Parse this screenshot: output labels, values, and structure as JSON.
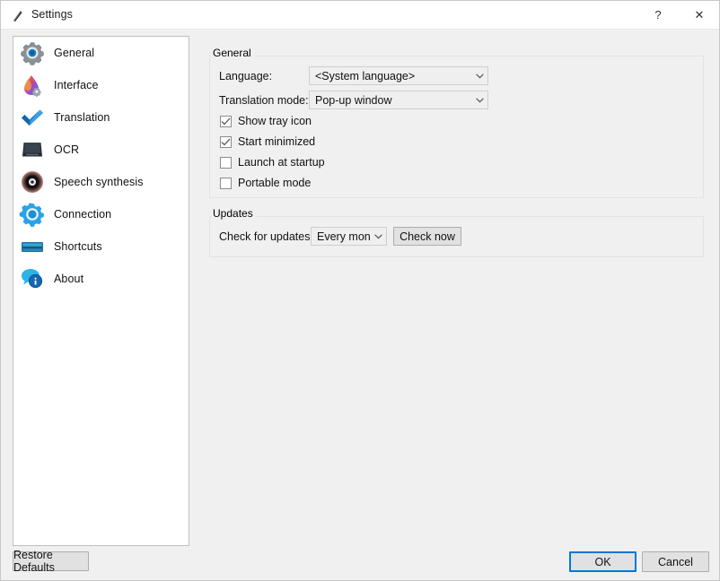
{
  "window": {
    "title": "Settings",
    "icon": "app-icon",
    "help_glyph": "?",
    "close_glyph": "✕"
  },
  "sidebar": {
    "items": [
      {
        "label": "General",
        "icon": "gear-icon",
        "selected": true
      },
      {
        "label": "Interface",
        "icon": "paint-drop-icon",
        "selected": false
      },
      {
        "label": "Translation",
        "icon": "blue-checkmark-icon",
        "selected": false
      },
      {
        "label": "OCR",
        "icon": "scanner-icon",
        "selected": false
      },
      {
        "label": "Speech synthesis",
        "icon": "speaker-disc-icon",
        "selected": false
      },
      {
        "label": "Connection",
        "icon": "blue-gear-icon",
        "selected": false
      },
      {
        "label": "Shortcuts",
        "icon": "keyboard-icon",
        "selected": false
      },
      {
        "label": "About",
        "icon": "info-bubble-icon",
        "selected": false
      }
    ]
  },
  "general": {
    "group_title": "General",
    "language_label": "Language:",
    "language_value": "<System language>",
    "translation_mode_label": "Translation mode:",
    "translation_mode_value": "Pop-up window",
    "checkboxes": [
      {
        "label": "Show tray icon",
        "checked": true
      },
      {
        "label": "Start minimized",
        "checked": true
      },
      {
        "label": "Launch at startup",
        "checked": false
      },
      {
        "label": "Portable mode",
        "checked": false
      }
    ]
  },
  "updates": {
    "group_title": "Updates",
    "check_label": "Check for updates:",
    "interval_value": "Every month",
    "check_now_label": "Check now"
  },
  "footer": {
    "restore_label": "Restore Defaults",
    "ok_label": "OK",
    "cancel_label": "Cancel"
  },
  "colors": {
    "accent": "#0078d7",
    "window_bg": "#f0f0f0",
    "panel_bg": "#ffffff"
  }
}
